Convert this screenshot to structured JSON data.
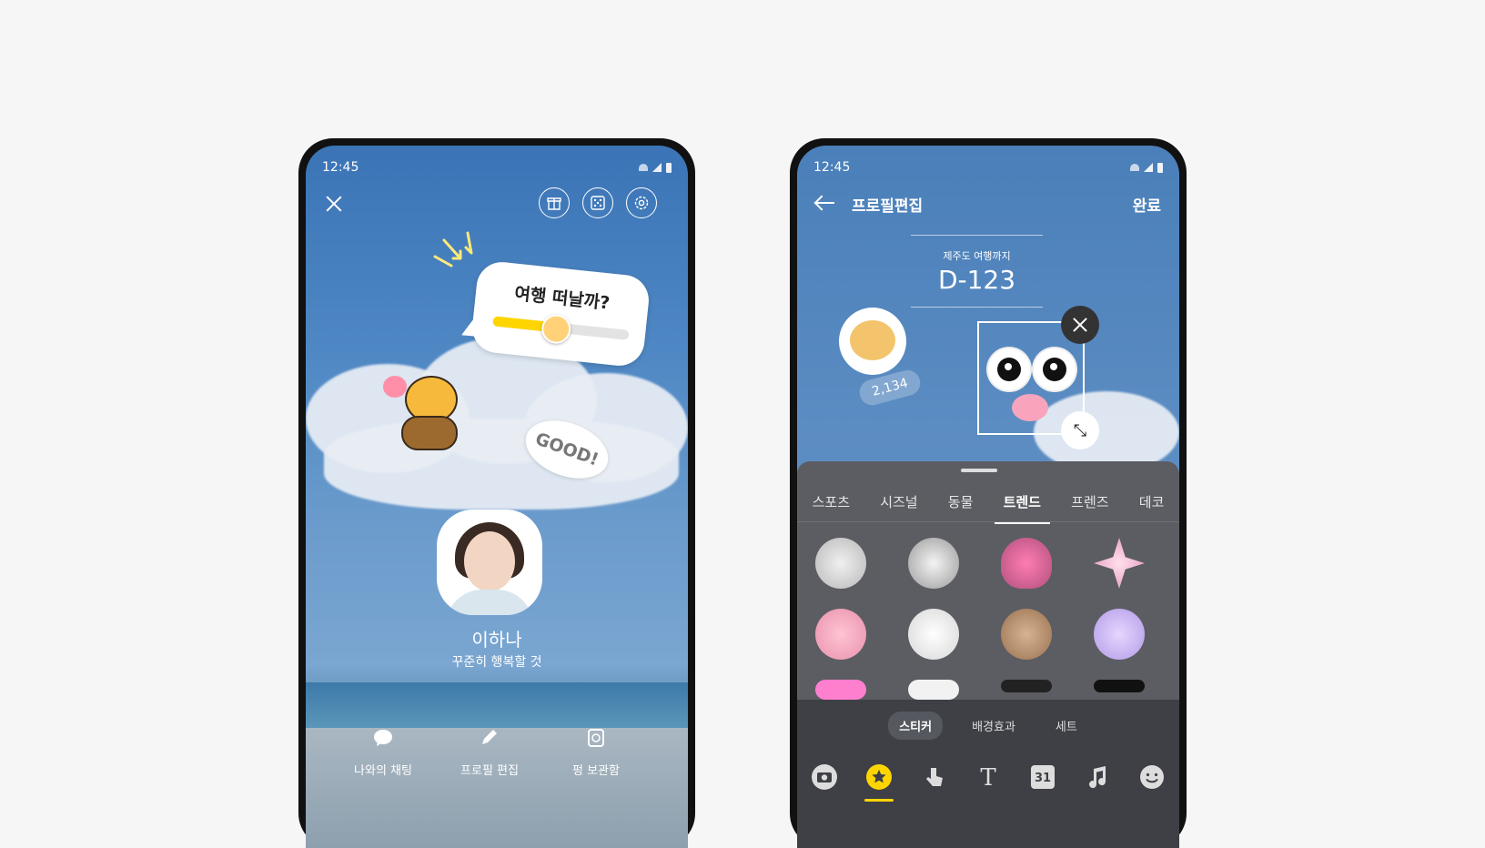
{
  "left_phone": {
    "status_bar": {
      "time": "12:45"
    },
    "header_icons": [
      "close-icon",
      "gift-box-icon",
      "dice-icon",
      "settings-icon"
    ],
    "poll_bubble": {
      "question": "여행 떠날까?",
      "slider_fraction": 0.45
    },
    "good_sticker": "GOOD!",
    "profile": {
      "name": "이하나",
      "status_message": "꾸준히 행복할 것"
    },
    "bottom_actions": [
      {
        "label": "나와의 채팅",
        "icon": "chat-bubble-icon"
      },
      {
        "label": "프로필 편집",
        "icon": "pencil-icon"
      },
      {
        "label": "펑 보관함",
        "icon": "archive-icon"
      }
    ]
  },
  "right_phone": {
    "status_bar": {
      "time": "12:45"
    },
    "header": {
      "title": "프로필편집",
      "done_label": "완료"
    },
    "dday": {
      "label": "제주도 여행까지",
      "value": "D-123"
    },
    "like_count": "2,134",
    "category_tabs": [
      "스포츠",
      "시즈널",
      "동물",
      "트렌드",
      "프렌즈",
      "데코"
    ],
    "active_category": "트렌드",
    "sub_tabs": [
      "스티커",
      "배경효과",
      "세트"
    ],
    "active_sub_tab": "스티커",
    "tools": [
      "camera-icon",
      "sticker-star-icon",
      "touch-hand-icon",
      "text-icon",
      "calendar-icon",
      "music-note-icon",
      "smiley-icon"
    ],
    "calendar_day": "31",
    "text_tool_glyph": "T",
    "colors": {
      "accent": "#ffd500",
      "panel": "#5b5d63",
      "panel_dark": "#3e4046"
    }
  }
}
